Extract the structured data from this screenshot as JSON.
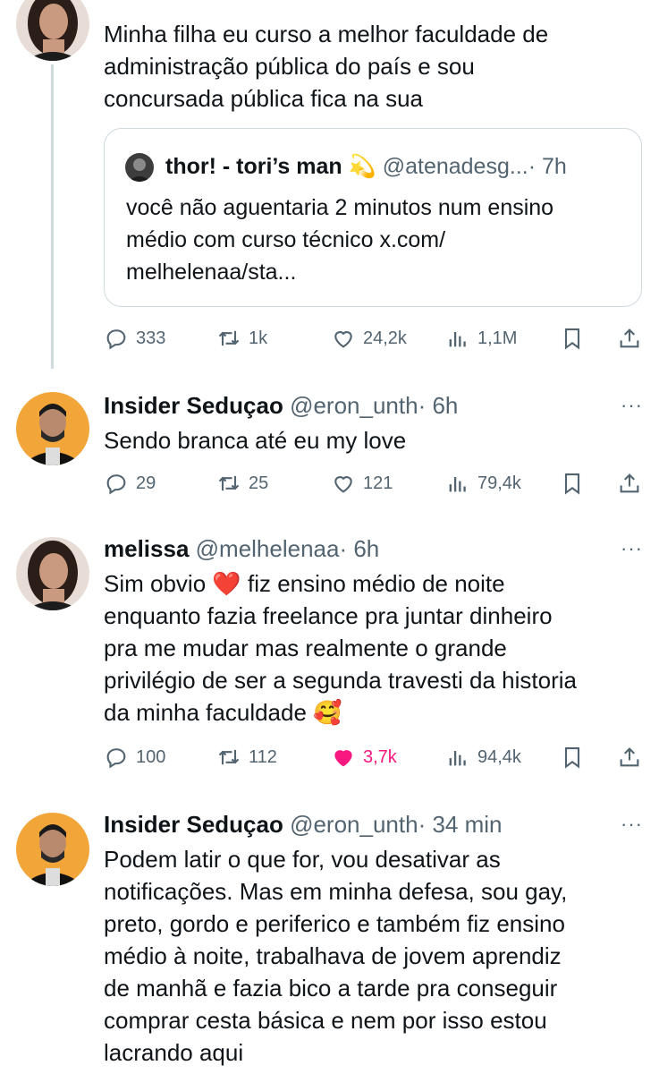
{
  "tweets": [
    {
      "text": "Minha filha eu curso a melhor faculdade de\nadministração pública do país e sou\nconcursada pública fica na sua",
      "quote": {
        "name": "thor! - tori’s man 💫",
        "handle": "@atenadesg...",
        "time": "· 7h",
        "text": "você não aguentaria 2 minutos num ensino\nmédio com curso técnico x.com/\nmelhelenaa/sta..."
      },
      "actions": {
        "replies": "333",
        "reposts": "1k",
        "likes": "24,2k",
        "views": "1,1M"
      }
    },
    {
      "name": "Insider Seduçao",
      "handle": "@eron_unth",
      "time": "· 6h",
      "text": "Sendo branca até eu my love",
      "actions": {
        "replies": "29",
        "reposts": "25",
        "likes": "121",
        "views": "79,4k"
      }
    },
    {
      "name": "melissa",
      "handle": "@melhelenaa",
      "time": "· 6h",
      "text": "Sim obvio ❤️  fiz ensino médio de noite\nenquanto fazia freelance pra juntar dinheiro\npra me mudar mas realmente o grande\nprivilégio de ser a segunda travesti da historia\nda minha faculdade 🥰",
      "actions": {
        "replies": "100",
        "reposts": "112",
        "likes": "3,7k",
        "views": "94,4k"
      }
    },
    {
      "name": "Insider Seduçao",
      "handle": "@eron_unth",
      "time": "· 34 min",
      "text": "Podem latir o que for, vou desativar as\nnotificações. Mas em minha defesa, sou gay,\npreto, gordo e periferico e também fiz ensino\nmédio à noite, trabalhava de jovem aprendiz\nde manhã e fazia bico a tarde pra conseguir\ncomprar cesta básica e nem por isso estou\nlacrando aqui"
    }
  ],
  "more_label": "···",
  "colors": {
    "accent_like": "#f91880",
    "meta": "#536471",
    "border": "#cfd9de"
  }
}
